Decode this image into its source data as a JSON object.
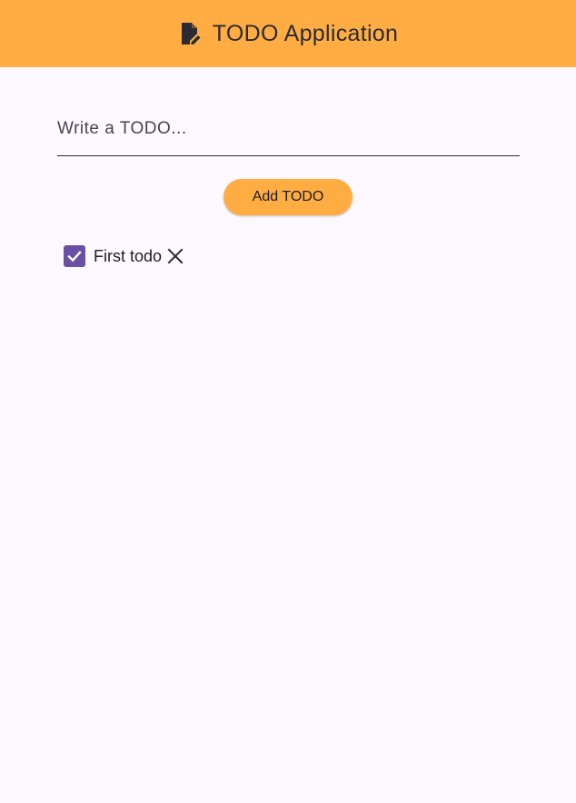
{
  "app_bar": {
    "icon": "edit-note-icon",
    "title": "TODO Application",
    "background": "#ffad42"
  },
  "form": {
    "input_placeholder": "Write a TODO...",
    "input_value": "",
    "add_button_label": "Add TODO"
  },
  "todos": [
    {
      "label": "First todo",
      "checked": true,
      "checkbox_icon": "check-icon",
      "delete_icon": "close-icon"
    }
  ],
  "colors": {
    "accent": "#ffad42",
    "checkbox": "#6a4fa3",
    "background": "#fdf8fd",
    "text": "#1e1e22"
  }
}
